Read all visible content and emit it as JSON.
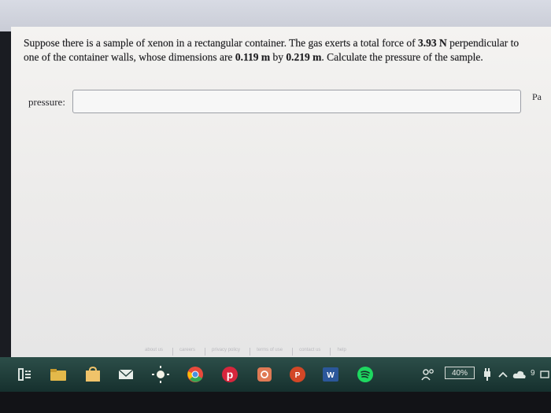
{
  "question": {
    "segments": [
      {
        "text": "Suppose there is a sample of xenon in a rectangular container. The gas exerts a total force of ",
        "bold": false
      },
      {
        "text": "3.93 N",
        "bold": true
      },
      {
        "text": " perpendicular to one of the container walls, whose dimensions are ",
        "bold": false
      },
      {
        "text": "0.119 m",
        "bold": true
      },
      {
        "text": " by ",
        "bold": false
      },
      {
        "text": "0.219 m",
        "bold": true
      },
      {
        "text": ". Calculate the pressure of the sample.",
        "bold": false
      }
    ]
  },
  "answer": {
    "label": "pressure:",
    "value": "",
    "unit": "Pa"
  },
  "footer_links": [
    "about us",
    "careers",
    "privacy policy",
    "terms of use",
    "contact us",
    "help"
  ],
  "taskbar": {
    "items": [
      {
        "name": "task-view-icon",
        "color": "#d9e2de"
      },
      {
        "name": "file-explorer-icon",
        "color": "#e4b94a"
      },
      {
        "name": "store-icon",
        "color": "#f0c36a"
      },
      {
        "name": "mail-icon",
        "color": "#e8eeea"
      },
      {
        "name": "brightness-icon",
        "color": "#f2f2e6"
      },
      {
        "name": "chrome-icon",
        "color": "#4a8fe0"
      },
      {
        "name": "pinterest-icon",
        "color": "#d7263d"
      },
      {
        "name": "instagram-icon",
        "color": "#e07a55"
      },
      {
        "name": "powerpoint-icon",
        "color": "#d24726"
      },
      {
        "name": "word-icon",
        "color": "#2b579a"
      },
      {
        "name": "spotify-icon",
        "color": "#1ed760"
      }
    ],
    "tray": {
      "battery_label": "40%",
      "tray_text": "9"
    }
  }
}
